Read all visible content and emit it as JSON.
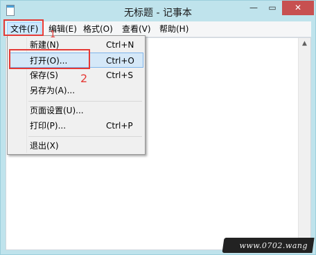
{
  "window": {
    "title": "无标题 - 记事本",
    "controls": {
      "minimize": "—",
      "maximize": "▭",
      "close": "✕"
    }
  },
  "menubar": {
    "items": [
      "文件(F)",
      "编辑(E)",
      "格式(O)",
      "查看(V)",
      "帮助(H)"
    ]
  },
  "file_menu": {
    "items": [
      {
        "label": "新建(N)",
        "shortcut": "Ctrl+N"
      },
      {
        "label": "打开(O)...",
        "shortcut": "Ctrl+O"
      },
      {
        "label": "保存(S)",
        "shortcut": "Ctrl+S"
      },
      {
        "label": "另存为(A)...",
        "shortcut": ""
      },
      {
        "label": "页面设置(U)...",
        "shortcut": ""
      },
      {
        "label": "打印(P)...",
        "shortcut": "Ctrl+P"
      },
      {
        "label": "退出(X)",
        "shortcut": ""
      }
    ]
  },
  "annotations": {
    "step1": "1",
    "step2": "2"
  },
  "watermark": "www.0702.wang",
  "colors": {
    "highlight_box": "#e53935",
    "selected_item": "#d5e8f8",
    "titlebar": "#bfe3ec"
  }
}
